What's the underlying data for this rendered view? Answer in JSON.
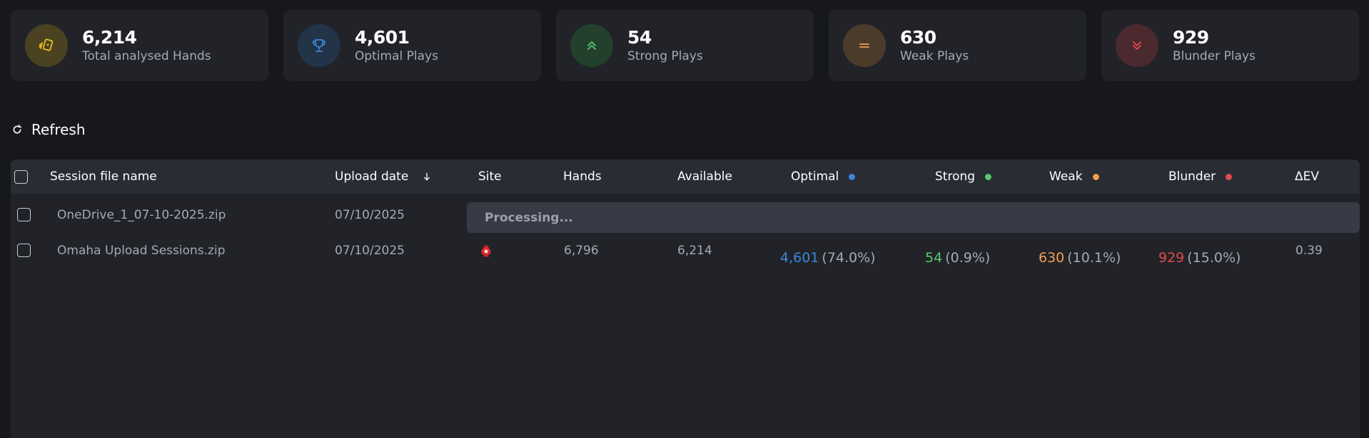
{
  "stats": [
    {
      "value": "6,214",
      "label": "Total analysed Hands",
      "icon": "cards-icon",
      "color": "#e8c020",
      "bg": "#4a4220"
    },
    {
      "value": "4,601",
      "label": "Optimal Plays",
      "icon": "trophy-icon",
      "color": "#3d86d6",
      "bg": "#233449"
    },
    {
      "value": "54",
      "label": "Strong Plays",
      "icon": "double-chevron-up-icon",
      "color": "#58c96a",
      "bg": "#22402b"
    },
    {
      "value": "630",
      "label": "Weak Plays",
      "icon": "equals-icon",
      "color": "#f0a04a",
      "bg": "#4b3b2b"
    },
    {
      "value": "929",
      "label": "Blunder Plays",
      "icon": "double-chevron-down-icon",
      "color": "#e04a4a",
      "bg": "#4a2a2e"
    }
  ],
  "toolbar": {
    "refresh_label": "Refresh"
  },
  "table": {
    "headers": {
      "name": "Session file name",
      "upload_date": "Upload date",
      "site": "Site",
      "hands": "Hands",
      "available": "Available",
      "optimal": "Optimal",
      "strong": "Strong",
      "weak": "Weak",
      "blunder": "Blunder",
      "dev": "ΔEV"
    },
    "status_colors": {
      "optimal": "#3d86d6",
      "strong": "#58c96a",
      "weak": "#f0a04a",
      "blunder": "#e04a4a"
    },
    "rows": [
      {
        "name": "OneDrive_1_07-10-2025.zip",
        "upload_date": "07/10/2025",
        "status": "Processing..."
      },
      {
        "name": "Omaha Upload Sessions.zip",
        "upload_date": "07/10/2025",
        "site_icon": "pokerstars-icon",
        "hands": "6,796",
        "available": "6,214",
        "optimal": "4,601",
        "optimal_pct": "(74.0%)",
        "strong": "54",
        "strong_pct": "(0.9%)",
        "weak": "630",
        "weak_pct": "(10.1%)",
        "blunder": "929",
        "blunder_pct": "(15.0%)",
        "dev": "0.39"
      }
    ]
  }
}
